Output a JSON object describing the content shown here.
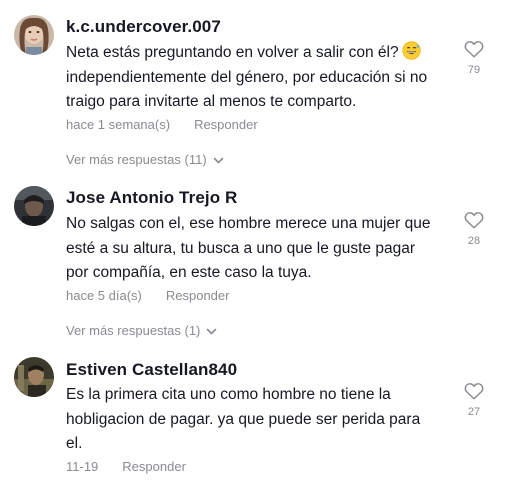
{
  "comments": [
    {
      "username": "k.c.undercover.007",
      "text_before_emoji": "Neta estás preguntando en volver a salir con él?",
      "emoji": "grinning-sweat-emoji",
      "text_line2": "independientemente del género, por educación si no",
      "text_line3": "traigo para invitarte al menos te comparto.",
      "time": "hace 1 semana(s)",
      "reply_label": "Responder",
      "likes": "79",
      "more_replies": "Ver más respuestas (11)"
    },
    {
      "username": "Jose Antonio Trejo R",
      "text_line1": "No salgas con el, ese hombre merece una mujer que",
      "text_line2": "esté a su altura, tu busca a uno que le guste pagar",
      "text_line3": "por compañía, en este caso la tuya.",
      "time": "hace 5 día(s)",
      "reply_label": "Responder",
      "likes": "28",
      "more_replies": "Ver más respuestas (1)"
    },
    {
      "username": "Estiven Castellan840",
      "text_line1": "Es la primera cita uno como hombre no tiene la",
      "text_line2": "hobligacion de pagar. ya que puede ser perida para",
      "text_line3": "el.",
      "time": "11-19",
      "reply_label": "Responder",
      "likes": "27"
    }
  ],
  "colors": {
    "text": "#161823",
    "secondary": "#8a8b91"
  },
  "icons": [
    "heart-outline-icon",
    "chevron-down-icon",
    "grinning-sweat-emoji"
  ]
}
